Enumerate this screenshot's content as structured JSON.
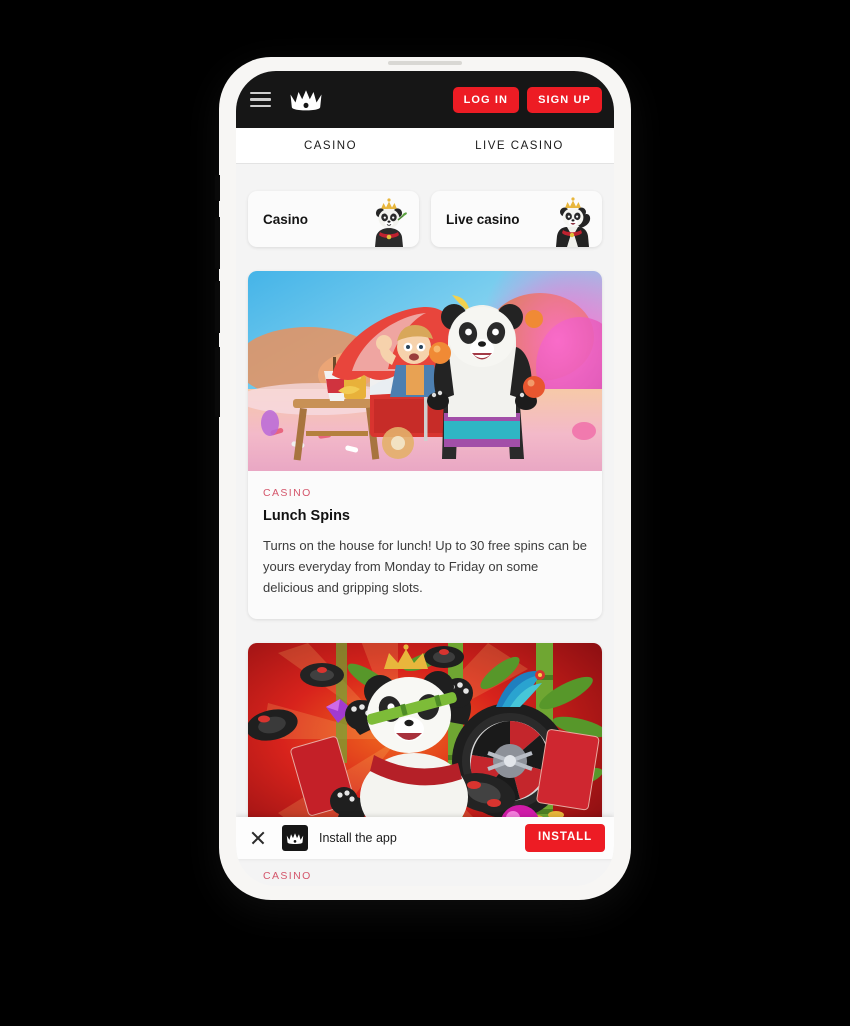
{
  "appbar": {
    "menu_icon": "hamburger-menu-icon",
    "logo_icon": "crown-logo-icon",
    "login_label": "LOG IN",
    "signup_label": "SIGN UP",
    "background_color": "#161616",
    "accent_color": "#ed1c24"
  },
  "tabs": [
    {
      "label": "CASINO",
      "active": true
    },
    {
      "label": "LIVE CASINO",
      "active": false
    }
  ],
  "quick_links": [
    {
      "label": "Casino",
      "art": "panda-king-icon"
    },
    {
      "label": "Live casino",
      "art": "panda-dealer-icon"
    }
  ],
  "promos": [
    {
      "kicker": "CASINO",
      "title": "Lunch Spins",
      "text": "Turns on the house for lunch! Up to 30 free spins can be yours everyday from Monday to Friday on some delicious and gripping slots.",
      "image": "panda-food-cart-candyland"
    },
    {
      "kicker": "CASINO",
      "image": "panda-bamboo-roulette"
    }
  ],
  "install_banner": {
    "close_icon": "close-icon",
    "app_icon": "crown-app-icon",
    "label": "Install the app",
    "button_label": "INSTALL",
    "button_color": "#ed1c24"
  }
}
